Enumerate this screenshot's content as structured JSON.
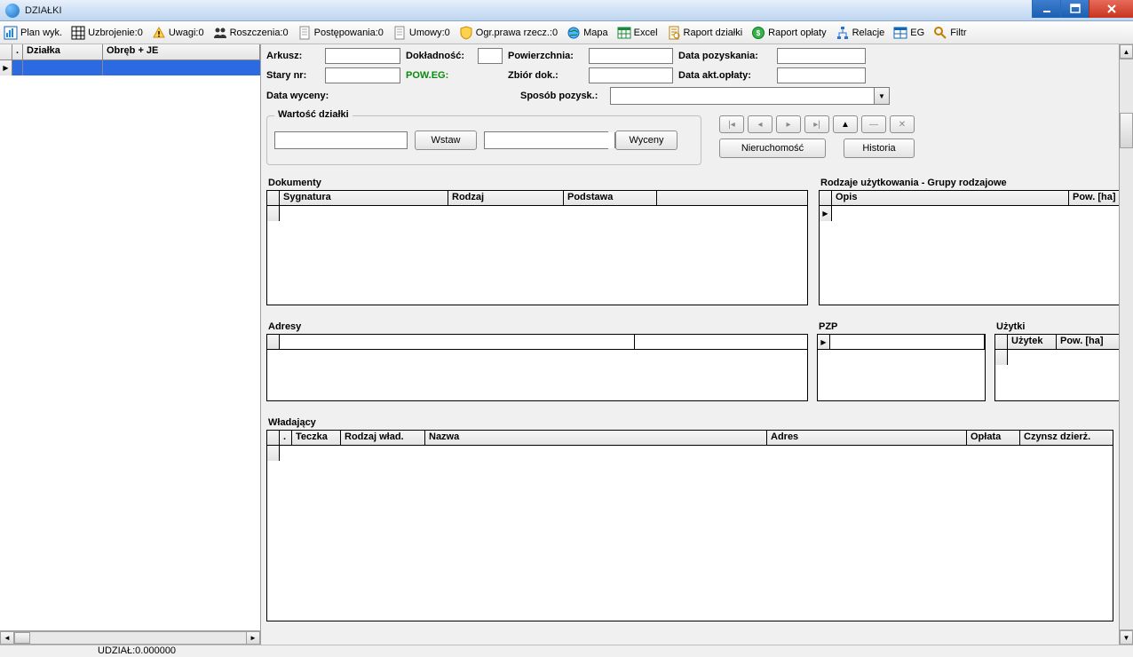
{
  "window": {
    "title": "DZIAŁKI"
  },
  "toolbar": [
    {
      "id": "plan-wyk",
      "label": "Plan wyk.",
      "icon": "chart-icon"
    },
    {
      "id": "uzbrojenie",
      "label": "Uzbrojenie:0",
      "icon": "grid-icon"
    },
    {
      "id": "uwagi",
      "label": "Uwagi:0",
      "icon": "warning-icon"
    },
    {
      "id": "roszczenia",
      "label": "Roszczenia:0",
      "icon": "people-icon"
    },
    {
      "id": "postepowania",
      "label": "Postępowania:0",
      "icon": "doc-icon"
    },
    {
      "id": "umowy",
      "label": "Umowy:0",
      "icon": "doc-icon"
    },
    {
      "id": "ogr-prawa",
      "label": "Ogr.prawa rzecz.:0",
      "icon": "shield-icon"
    },
    {
      "id": "mapa",
      "label": "Mapa",
      "icon": "globe-icon"
    },
    {
      "id": "excel",
      "label": "Excel",
      "icon": "table-icon"
    },
    {
      "id": "raport-dzialki",
      "label": "Raport działki",
      "icon": "report-icon"
    },
    {
      "id": "raport-oplaty",
      "label": "Raport opłaty",
      "icon": "money-icon"
    },
    {
      "id": "relacje",
      "label": "Relacje",
      "icon": "tree-icon"
    },
    {
      "id": "eg",
      "label": "EG",
      "icon": "table2-icon"
    },
    {
      "id": "filtr",
      "label": "Filtr",
      "icon": "search-icon"
    }
  ],
  "left_grid": {
    "columns": {
      "dot": ".",
      "dzialka": "Działka",
      "obreb": "Obręb + JE"
    }
  },
  "form": {
    "arkusz_label": "Arkusz:",
    "dokladnosc_label": "Dokładność:",
    "powierzchnia_label": "Powierzchnia:",
    "data_pozyskania_label": "Data pozyskania:",
    "stary_nr_label": "Stary nr:",
    "pow_eg_label": "POW.EG:",
    "zbior_dok_label": "Zbiór dok.:",
    "data_akt_oplaty_label": "Data akt.opłaty:",
    "data_wyceny_label": "Data wyceny:",
    "sposob_pozysk_label": "Sposób pozysk.:"
  },
  "wartosc": {
    "legend": "Wartość działki",
    "wstaw": "Wstaw",
    "wyceny": "Wyceny"
  },
  "buttons": {
    "nieruchomosc": "Nieruchomość",
    "historia": "Historia"
  },
  "sections": {
    "dokumenty": {
      "title": "Dokumenty",
      "cols": {
        "sygnatura": "Sygnatura",
        "rodzaj": "Rodzaj",
        "podstawa": "Podstawa"
      }
    },
    "rodzaje": {
      "title": "Rodzaje użytkowania - Grupy rodzajowe",
      "cols": {
        "opis": "Opis",
        "pow": "Pow. [ha]"
      }
    },
    "adresy": {
      "title": "Adresy"
    },
    "pzp": {
      "title": "PZP"
    },
    "uzytki": {
      "title": "Użytki",
      "cols": {
        "uzytek": "Użytek",
        "pow": "Pow. [ha]"
      }
    },
    "wladajacy": {
      "title": "Władający",
      "cols": {
        "dot": ".",
        "teczka": "Teczka",
        "rodzaj": "Rodzaj wład.",
        "nazwa": "Nazwa",
        "adres": "Adres",
        "oplata": "Opłata",
        "czynsz": "Czynsz dzierż."
      }
    }
  },
  "statusbar": {
    "text": "UDZIAŁ:0.000000"
  }
}
